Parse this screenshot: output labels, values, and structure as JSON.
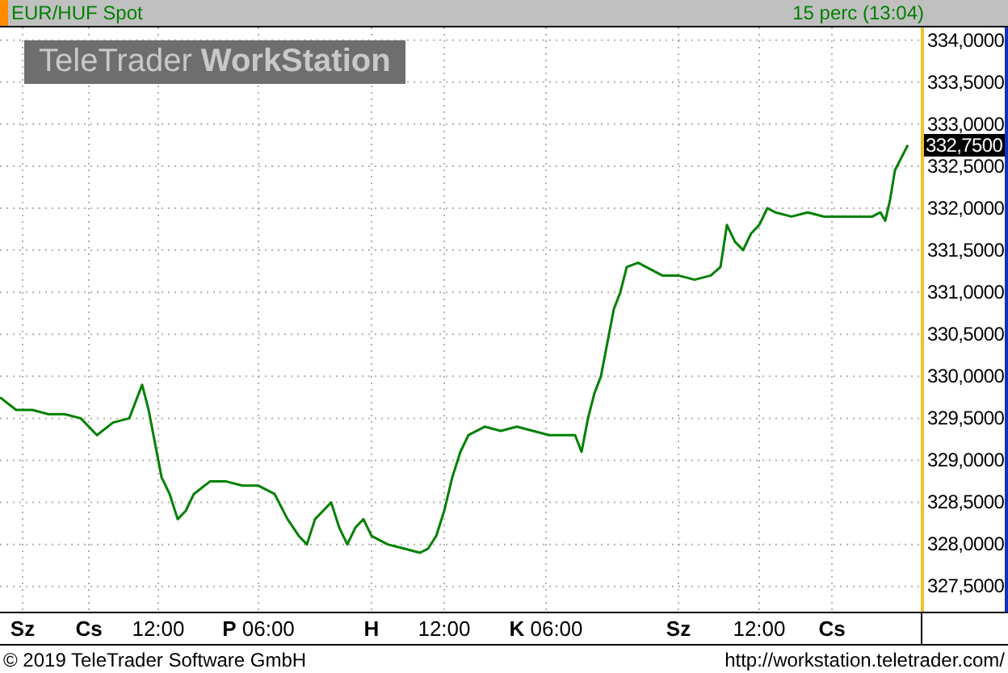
{
  "header": {
    "title": "EUR/HUF Spot",
    "delay": "15 perc (13:04)"
  },
  "logo": {
    "text": "TeleTrader **WorkStation**"
  },
  "chart": {
    "last_price": "332,7500",
    "y_axis_labels": [
      "334,0000",
      "333,5000",
      "333,0000",
      "332,5000",
      "332,0000",
      "331,5000",
      "331,0000",
      "330,5000",
      "330,0000",
      "329,5000",
      "329,0000",
      "328,5000",
      "328,0000",
      "327,5000"
    ],
    "x_axis_labels": [
      "**Sz**",
      "**Cs**",
      "12:00",
      "**P** 06:00",
      "**H**",
      "12:00",
      "**K** 06:00",
      "**Sz**",
      "12:00",
      "**Cs**"
    ]
  },
  "footer": {
    "copyright": "© 2019 TeleTrader Software GmbH",
    "url": "http://workstation.teletrader.com/"
  }
}
